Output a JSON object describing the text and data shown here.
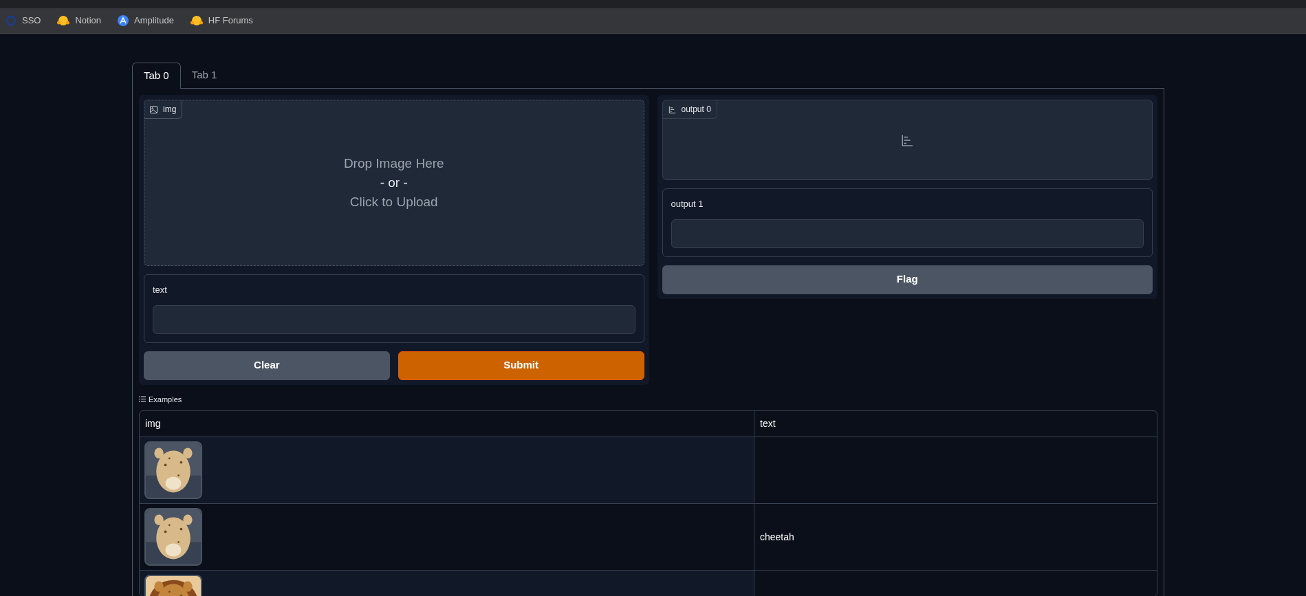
{
  "browser": {
    "bookmarks": [
      {
        "label": "SSO",
        "kind": "ring"
      },
      {
        "label": "Notion",
        "kind": "emoji"
      },
      {
        "label": "Amplitude",
        "kind": "badge"
      },
      {
        "label": "HF Forums",
        "kind": "emoji"
      }
    ]
  },
  "tabs": [
    {
      "label": "Tab 0",
      "selected": true
    },
    {
      "label": "Tab 1",
      "selected": false
    }
  ],
  "image_input": {
    "label": "img",
    "prompt": [
      {
        "text": "Drop Image Here",
        "kind": "hint"
      },
      {
        "text": "- or -",
        "kind": "separator"
      },
      {
        "text": "Click to Upload",
        "kind": "hint"
      }
    ]
  },
  "text_input": {
    "label": "text"
  },
  "buttons": [
    {
      "label": "Clear",
      "kind": "secondary"
    },
    {
      "label": "Submit",
      "kind": "primary"
    }
  ],
  "output_0": {
    "label": "output 0"
  },
  "output_1": {
    "label": "output 1"
  },
  "flag_button": {
    "label": "Flag"
  },
  "examples": {
    "label": "Examples",
    "columns": [
      "img",
      "text"
    ],
    "rows": [
      {
        "img": {
          "kind": "picture"
        }
      },
      {
        "img": {
          "kind": "picture"
        },
        "text": "cheetah"
      },
      {
        "img": {
          "kind": "picture"
        }
      }
    ]
  }
}
